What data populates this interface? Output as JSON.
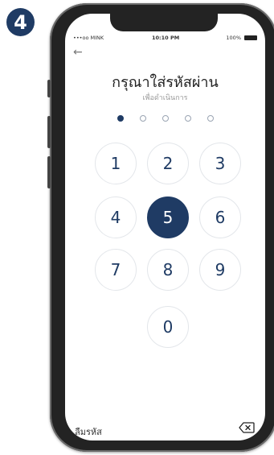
{
  "step": {
    "number": "4"
  },
  "status_bar": {
    "carrier": "•••oo MINK",
    "time": "10:10 PM",
    "battery": "100%"
  },
  "screen": {
    "title": "กรุณาใส่รหัสผ่าน",
    "subtitle": "เพื่อดำเนินการ",
    "pin": {
      "length": 5,
      "filled": 1
    },
    "keys": [
      "1",
      "2",
      "3",
      "4",
      "5",
      "6",
      "7",
      "8",
      "9",
      "0"
    ],
    "active_key": "5",
    "forgot_label": "ลืมรหัส"
  },
  "icons": {
    "back": "back-arrow-icon",
    "backspace": "backspace-icon",
    "signal": "wifi-icon"
  },
  "colors": {
    "primary": "#1f3b64",
    "badge": "#1f3b64",
    "key_border": "#e3e6ea"
  }
}
